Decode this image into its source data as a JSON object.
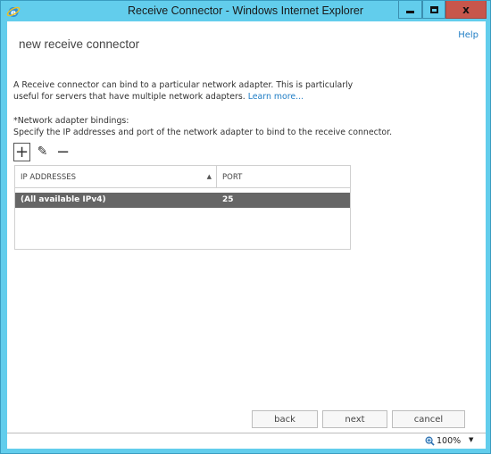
{
  "window": {
    "title": "Receive Connector - Windows Internet Explorer",
    "minimize_glyph": "",
    "close_glyph": "x"
  },
  "page": {
    "title": "new receive connector",
    "help_link": "Help",
    "description": "A Receive connector can bind to a particular network adapter. This is particularly useful for servers that have multiple network adapters.",
    "learn_more": "Learn more...",
    "bindings_label": "*Network adapter bindings:",
    "bindings_sublabel": "Specify the IP addresses and port of the network adapter to bind to the receive connector."
  },
  "toolbar": {
    "add_glyph": "+",
    "edit_glyph": "✎",
    "remove_glyph": "−"
  },
  "grid": {
    "columns": [
      {
        "label": "IP ADDRESSES",
        "sort": "ascending"
      },
      {
        "label": "PORT"
      }
    ],
    "sort_glyph": "▲",
    "rows": [
      {
        "ip": "(All available IPv4)",
        "port": "25",
        "selected": true
      }
    ]
  },
  "buttons": {
    "back": "back",
    "next": "next",
    "cancel": "cancel"
  },
  "statusbar": {
    "zoom": "100%",
    "dropdown_glyph": "▼"
  }
}
